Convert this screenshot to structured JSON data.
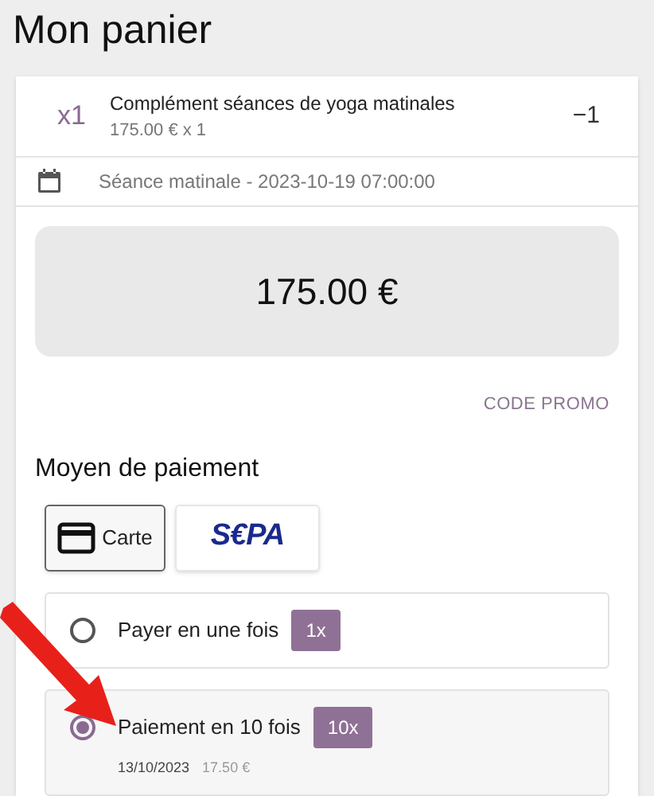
{
  "title": "Mon panier",
  "cart_item": {
    "quantity": "x1",
    "name": "Complément séances de yoga matinales",
    "price_line": "175.00 € x 1",
    "remove": "−1"
  },
  "session": {
    "label": "Séance matinale - 2023-10-19 07:00:00"
  },
  "total": "175.00 €",
  "promo_button": "CODE PROMO",
  "payment_heading": "Moyen de paiement",
  "payment_methods": [
    {
      "kind": "card",
      "label": "Carte",
      "selected": true
    },
    {
      "kind": "sepa",
      "label": "S€PA",
      "selected": false
    }
  ],
  "payment_options": [
    {
      "label": "Payer en une fois",
      "badge": "1x",
      "selected": false
    },
    {
      "label": "Paiement en 10 fois",
      "badge": "10x",
      "selected": true,
      "schedule": [
        {
          "date": "13/10/2023",
          "amount": "17.50 €"
        }
      ]
    }
  ]
}
